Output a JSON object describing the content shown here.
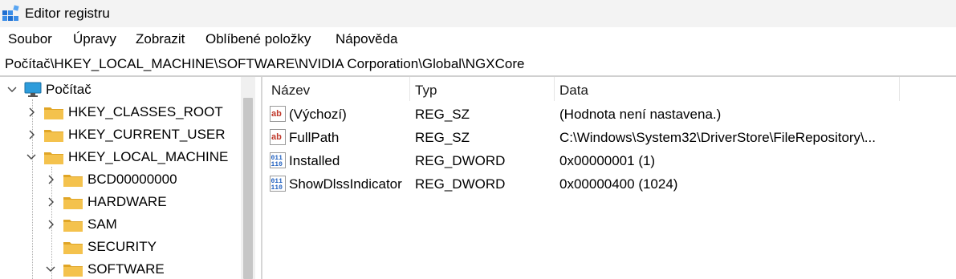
{
  "window": {
    "title": "Editor registru"
  },
  "menu": [
    "Soubor",
    "Úpravy",
    "Zobrazit",
    "Oblíbené položky",
    "Nápověda"
  ],
  "address": "Počítač\\HKEY_LOCAL_MACHINE\\SOFTWARE\\NVIDIA Corporation\\Global\\NGXCore",
  "tree": {
    "root": "Počítač",
    "hives": [
      "HKEY_CLASSES_ROOT",
      "HKEY_CURRENT_USER",
      "HKEY_LOCAL_MACHINE"
    ],
    "children": [
      "BCD00000000",
      "HARDWARE",
      "SAM",
      "SECURITY",
      "SOFTWARE"
    ]
  },
  "columns": {
    "name": "Název",
    "type": "Typ",
    "data": "Data"
  },
  "values": [
    {
      "name": "(Výchozí)",
      "type": "REG_SZ",
      "data": "(Hodnota není nastavena.)",
      "icon": "string-value-icon"
    },
    {
      "name": "FullPath",
      "type": "REG_SZ",
      "data": "C:\\Windows\\System32\\DriverStore\\FileRepository\\...",
      "icon": "string-value-icon"
    },
    {
      "name": "Installed",
      "type": "REG_DWORD",
      "data": "0x00000001 (1)",
      "icon": "binary-value-icon"
    },
    {
      "name": "ShowDlssIndicator",
      "type": "REG_DWORD",
      "data": "0x00000400 (1024)",
      "icon": "binary-value-icon"
    }
  ],
  "colors": {
    "folder": "#f4c24d",
    "folder_dark": "#e0a526",
    "string_icon": "#c0392b",
    "binary_icon": "#1f5fbf"
  }
}
